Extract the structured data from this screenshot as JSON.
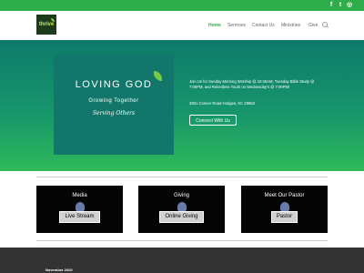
{
  "topbar": {
    "social": [
      {
        "icon": "facebook-icon",
        "glyph": "f"
      },
      {
        "icon": "twitter-icon",
        "glyph": "t"
      },
      {
        "icon": "instagram-icon",
        "glyph": "◎"
      }
    ]
  },
  "logo": {
    "text": "thrive"
  },
  "nav": [
    {
      "label": "Home",
      "active": true
    },
    {
      "label": "Sermons"
    },
    {
      "label": "Contact Us"
    },
    {
      "label": "Ministries"
    },
    {
      "label": "Give"
    }
  ],
  "hero": {
    "card_title": "LOVING GOD",
    "card_subtitle": "Growing Together",
    "card_script": "Serving Others",
    "text": "Join Us for Sunday Morning Worship @ 10:45AM, Tuesday Bible Study @ 7:00PM, and Relentless Youth on Wednesday's @ 7:00PM!",
    "address": "3601 Conner Road Hodges, SC  29653",
    "button_label": "Connect With Us"
  },
  "cards": [
    {
      "title": "Media",
      "button": "Live Stream"
    },
    {
      "title": "Giving",
      "button": "Online Giving"
    },
    {
      "title": "Meet Our Pastor",
      "button": "Pastor"
    }
  ],
  "footer": {
    "text": "November 2020"
  },
  "colors": {
    "accent": "#2fad4a",
    "hero_top": "#0e7a6a",
    "hero_bottom": "#2fb95a",
    "footer": "#333333"
  }
}
